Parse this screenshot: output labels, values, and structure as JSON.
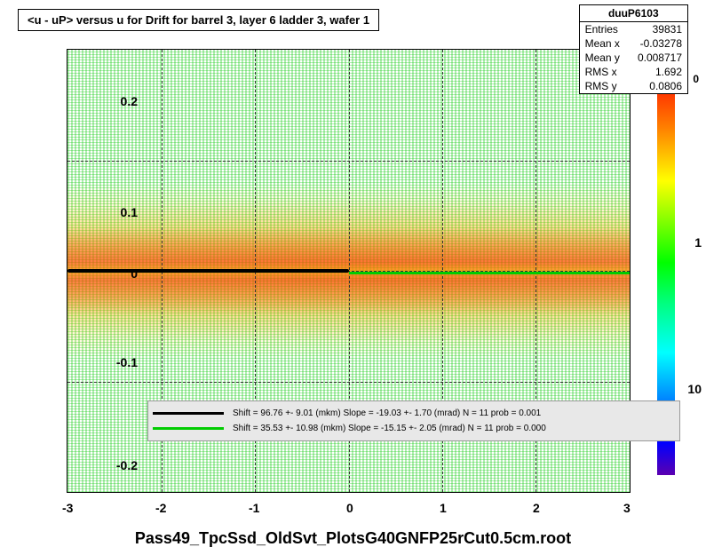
{
  "chart_data": {
    "type": "heatmap",
    "title": "<u - uP>       versus   u for Drift for barrel 3, layer 6 ladder 3, wafer 1",
    "xlabel": "",
    "ylabel": "",
    "xlim": [
      -3,
      3
    ],
    "ylim": [
      -0.2,
      0.2
    ],
    "xticks": [
      -3,
      -2,
      -1,
      0,
      1,
      2,
      3
    ],
    "yticks": [
      -0.2,
      -0.1,
      0,
      0.1,
      0.2
    ],
    "colorbar_scale": "log",
    "colorbar_ticks": [
      1,
      10
    ],
    "colorbar_extra_label": "0",
    "fit_curves": [
      {
        "color": "black",
        "range": [
          -3,
          0
        ],
        "approx_y": 0.01
      },
      {
        "color": "green",
        "range": [
          0,
          3
        ],
        "approx_y": 0.005
      }
    ],
    "density_description": "2D histogram with highest density band concentrated near y≈0 across full x range; colors from green (low) through yellow/orange to red (high) near center band"
  },
  "stats": {
    "name": "duuP6103",
    "entries": "39831",
    "mean_x_label": "Mean x",
    "mean_x": "-0.03278",
    "mean_y_label": "Mean y",
    "mean_y": "0.008717",
    "rms_x_label": "RMS x",
    "rms_x": "1.692",
    "rms_y_label": "RMS y",
    "rms_y": "0.0806",
    "entries_label": "Entries"
  },
  "legend": {
    "line1_text": "Shift =    96.76 +- 9.01 (mkm) Slope =   -19.03 +- 1.70 (mrad)  N = 11 prob = 0.001",
    "line2_text": "Shift =    35.53 +- 10.98 (mkm) Slope =   -15.15 +- 2.05 (mrad)  N = 11 prob = 0.000"
  },
  "caption": "Pass49_TpcSsd_OldSvt_PlotsG40GNFP25rCut0.5cm.root",
  "colorbar": {
    "tick1": "1",
    "tick10": "10",
    "extra": "0"
  },
  "axis": {
    "x_m3": "-3",
    "x_m2": "-2",
    "x_m1": "-1",
    "x_0": "0",
    "x_1": "1",
    "x_2": "2",
    "x_3": "3",
    "y_m02": "-0.2",
    "y_m01": "-0.1",
    "y_0": "0",
    "y_01": "0.1",
    "y_02": "0.2"
  }
}
